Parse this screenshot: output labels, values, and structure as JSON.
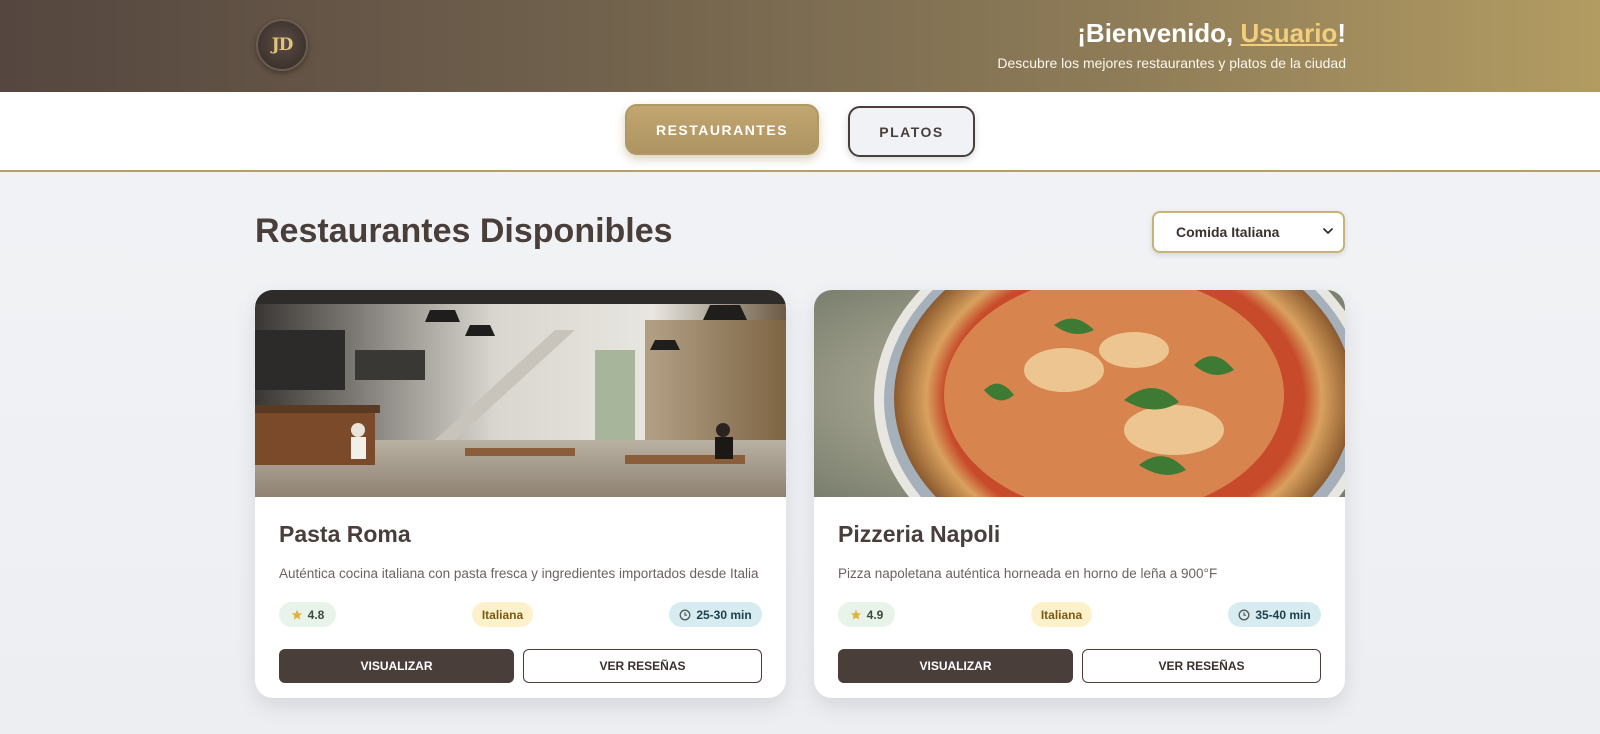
{
  "header": {
    "logo_text": "JD",
    "welcome_prefix": "¡Bienvenido, ",
    "welcome_user": "Usuario",
    "welcome_suffix": "!",
    "subtitle": "Descubre los mejores restaurantes y platos de la ciudad"
  },
  "nav": {
    "tabs": [
      {
        "label": "RESTAURANTES",
        "active": true
      },
      {
        "label": "PLATOS",
        "active": false
      }
    ]
  },
  "main": {
    "title": "Restaurantes Disponibles",
    "filter": {
      "selected": "Comida Italiana"
    }
  },
  "restaurants": [
    {
      "name": "Pasta Roma",
      "description": "Auténtica cocina italiana con pasta fresca y ingredientes importados desde Italia",
      "rating": "4.8",
      "cuisine": "Italiana",
      "time": "25-30 min",
      "view_label": "VISUALIZAR",
      "reviews_label": "VER RESEÑAS"
    },
    {
      "name": "Pizzeria Napoli",
      "description": "Pizza napoletana auténtica horneada en horno de leña a 900°F",
      "rating": "4.9",
      "cuisine": "Italiana",
      "time": "35-40 min",
      "view_label": "VISUALIZAR",
      "reviews_label": "VER RESEÑAS"
    }
  ],
  "colors": {
    "brand_dark": "#4a3e3b",
    "brand_gold": "#b39c62",
    "accent_user": "#f3cf7c"
  }
}
